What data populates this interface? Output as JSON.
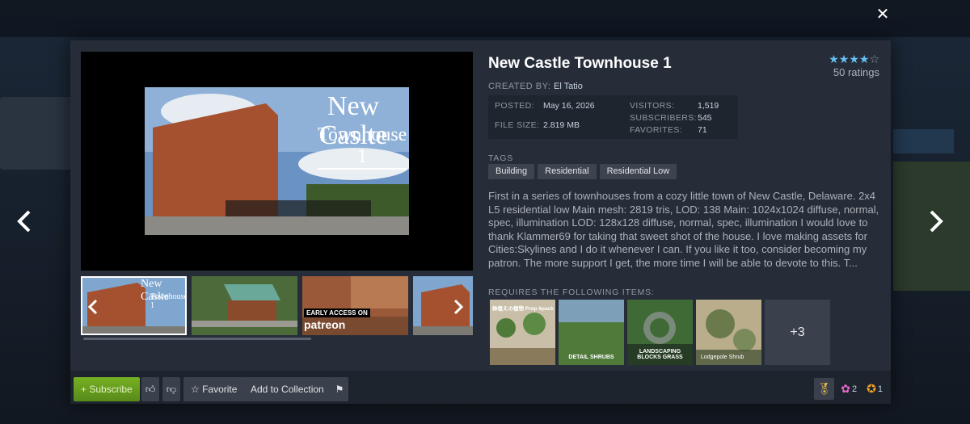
{
  "item": {
    "title": "New Castle Townhouse 1",
    "created_by_label": "CREATED BY:",
    "author": "El Tatio"
  },
  "rating": {
    "stars_filled": 4,
    "stars_total": 5,
    "count_text": "50 ratings"
  },
  "stats": {
    "posted_label": "POSTED:",
    "posted": "May 16, 2026",
    "file_size_label": "FILE SIZE:",
    "file_size": "2.819 MB",
    "visitors_label": "VISITORS:",
    "visitors": "1,519",
    "subscribers_label": "SUBSCRIBERS:",
    "subscribers": "545",
    "favorites_label": "FAVORITES:",
    "favorites": "71"
  },
  "tags": {
    "label": "TAGS",
    "items": [
      "Building",
      "Residential",
      "Residential Low"
    ]
  },
  "description": "First in a series of townhouses from a cozy little town of New Castle, Delaware. 2x4 L5 residential low Main mesh: 2819 tris, LOD: 138 Main: 1024x1024 diffuse, normal, spec, illumination LOD: 128x128 diffuse, normal, spec, illumination I would love to thank Klammer69 for taking that sweet shot of the house. I love making assets for Cities:Skylines and I do it whenever I can. If you like it too, consider becoming my patron. The more support I get, the more time I will be able to devote to this. T...",
  "preview": {
    "title_line1": "New Caslte",
    "title_line2": "Townhouse 1"
  },
  "thumbnails": {
    "first_title": "New Caslte",
    "first_sub": "Townhouse 1",
    "patreon_badge": "EARLY ACCESS ON",
    "patreon_logo": "patreon"
  },
  "requires": {
    "label": "REQUIRES THE FOLLOWING ITEMS:",
    "items": [
      {
        "caption_top": "鉢植えの植物 Prop 6pack",
        "caption": ""
      },
      {
        "caption_top": "",
        "caption": "DETAIL SHRUBS"
      },
      {
        "caption_top": "",
        "caption": "LANDSCAPING BLOCKS GRASS"
      },
      {
        "caption_top": "",
        "caption": "Lodgepole Shrub"
      }
    ],
    "more": "+3"
  },
  "footer": {
    "subscribe": "+ Subscribe",
    "favorite": "☆ Favorite",
    "add_to_collection": "Add to Collection",
    "awards": [
      {
        "icon": "award-icon",
        "count": ""
      },
      {
        "icon": "flower-award-icon",
        "count": "2"
      },
      {
        "icon": "medal-award-icon",
        "count": "1"
      }
    ]
  },
  "colors": {
    "accent": "#66c0f4",
    "subscribe_green": "#75b022",
    "panel": "#262d39"
  }
}
